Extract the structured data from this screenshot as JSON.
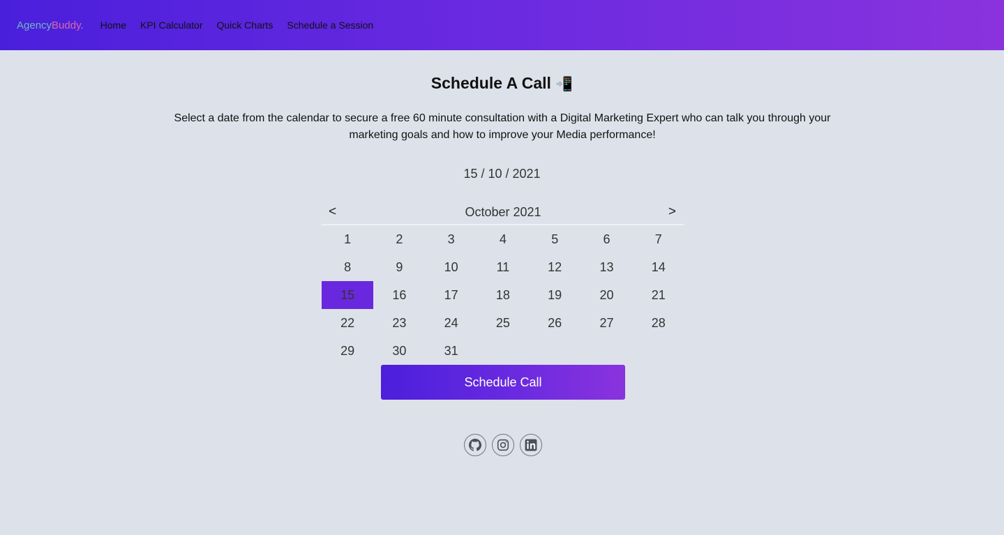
{
  "brand": {
    "part1": "Agency",
    "part2": "Buddy",
    "part3": "."
  },
  "nav": {
    "home": "Home",
    "kpi": "KPI Calculator",
    "charts": "Quick Charts",
    "schedule": "Schedule a Session"
  },
  "page": {
    "title": "Schedule A Call",
    "title_icon": "📲",
    "description": "Select a date from the calendar to secure a free 60 minute consultation with a Digital Marketing Expert who can talk you through your marketing goals and how to improve your Media performance!",
    "selected_date": "15 / 10 / 2021"
  },
  "calendar": {
    "prev": "<",
    "next": ">",
    "month_label": "October 2021",
    "days": [
      "1",
      "2",
      "3",
      "4",
      "5",
      "6",
      "7",
      "8",
      "9",
      "10",
      "11",
      "12",
      "13",
      "14",
      "15",
      "16",
      "17",
      "18",
      "19",
      "20",
      "21",
      "22",
      "23",
      "24",
      "25",
      "26",
      "27",
      "28",
      "29",
      "30",
      "31"
    ],
    "selected_day": "15",
    "accent": "#6a28de"
  },
  "actions": {
    "schedule_button": "Schedule Call"
  },
  "socials": [
    {
      "icon": "github-icon"
    },
    {
      "icon": "instagram-icon"
    },
    {
      "icon": "linkedin-icon"
    }
  ]
}
